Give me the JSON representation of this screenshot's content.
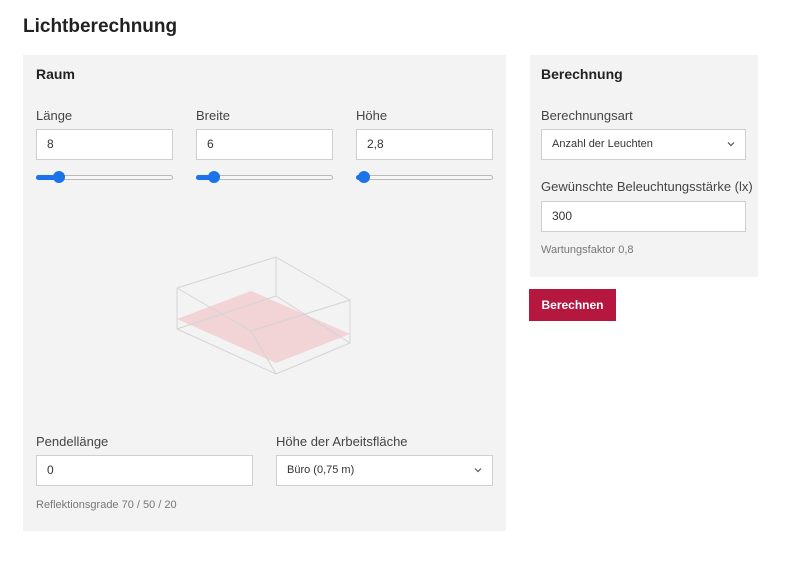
{
  "page": {
    "title": "Lichtberechnung"
  },
  "raum": {
    "title": "Raum",
    "laenge": {
      "label": "Länge",
      "value": "8",
      "slider_fraction": 0.17
    },
    "breite": {
      "label": "Breite",
      "value": "6",
      "slider_fraction": 0.13
    },
    "hoehe": {
      "label": "Höhe",
      "value": "2,8",
      "slider_fraction": 0.06
    },
    "pendellaenge": {
      "label": "Pendellänge",
      "value": "0"
    },
    "arbeitsflaeche": {
      "label": "Höhe der Arbeitsfläche",
      "selected": "Büro (0,75 m)"
    },
    "reflektionsgrade": "Reflektionsgrade 70 / 50 / 20"
  },
  "berechnung": {
    "title": "Berechnung",
    "art": {
      "label": "Berechnungsart",
      "selected": "Anzahl der Leuchten"
    },
    "lux": {
      "label": "Gewünschte Beleuchtungsstärke (lx)",
      "value": "300"
    },
    "wartungsfaktor": "Wartungsfaktor 0,8",
    "button": "Berechnen"
  },
  "colors": {
    "accent": "#b5173e",
    "slider": "#1a73e8",
    "panel": "#f3f3f3",
    "work_plane": "#f2d3d6"
  }
}
